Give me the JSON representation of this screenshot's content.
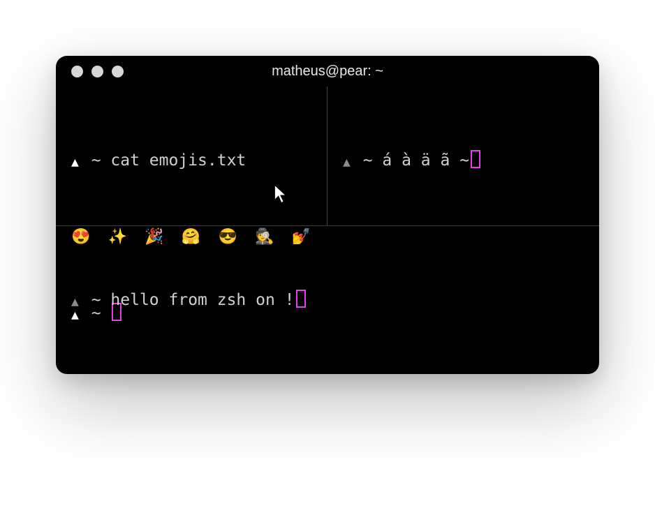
{
  "window": {
    "title": "matheus@pear: ~"
  },
  "colors": {
    "cursor_border": "#e83fe8",
    "pane_border": "#3e3e3e",
    "traffic_dot": "#d7d7d7"
  },
  "panes": {
    "top_left": {
      "line1_prompt_arrow": "▲",
      "line1_dir": "~",
      "line1_command": "cat emojis.txt",
      "line2_output": "😍 ✨ 🎉 🤗 😎 🕵️ 💅",
      "line3_prompt_arrow": "▲",
      "line3_dir": "~"
    },
    "top_right": {
      "prompt_arrow": "▲",
      "dir": "~",
      "input_text": "á à ä ã ~"
    },
    "bottom": {
      "prompt_arrow": "▲",
      "dir": "~",
      "text_before_apple": "hello from zsh on ",
      "apple_glyph": "",
      "text_after_apple": "!"
    }
  }
}
